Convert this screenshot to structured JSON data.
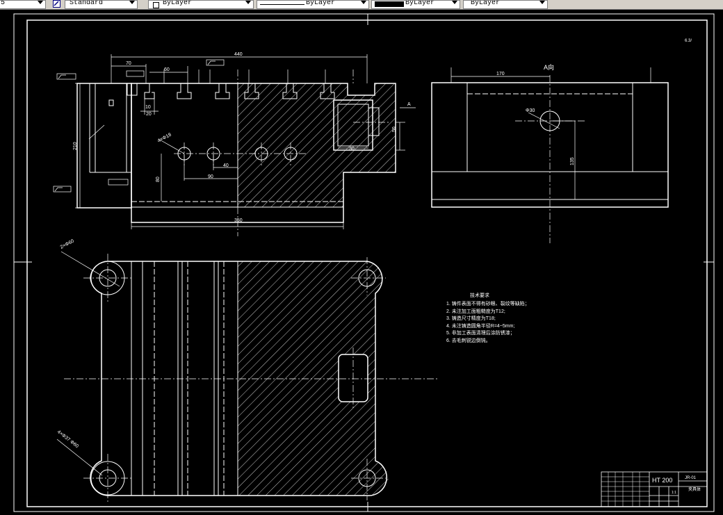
{
  "toolbar": {
    "fields": [
      {
        "value": "5"
      },
      {
        "value": "Standard"
      },
      {
        "value": "ByLayer"
      },
      {
        "value": "ByLayer"
      },
      {
        "value": "ByLayer"
      },
      {
        "value": "ByLayer"
      }
    ]
  },
  "drawing": {
    "section_label": "A",
    "view_label": "A向",
    "roughness_top": "6.3/",
    "notes_title": "技术要求",
    "notes": [
      "1. 铸件表面不得有砂眼、裂纹等缺陷；",
      "2. 未注加工面粗糙度为T12;",
      "3. 铸造尺寸精度为T18;",
      "4. 未注铸造圆角半径R=4~5mm;",
      "5. 非加工表面清理后涂防锈漆；",
      "6. 去毛刺锐边倒钝。"
    ],
    "dims": {
      "d440": "440",
      "d70": "70",
      "d60": "60",
      "d10": "10",
      "d20": "20",
      "d210": "210",
      "d50": "50",
      "d90": "90",
      "d40": "40",
      "d80": "80",
      "d350": "350",
      "d170": "170",
      "d135": "135",
      "d30": "30",
      "d4018": "4×Φ18",
      "phi30": "Φ30",
      "d2phi": "2×Φ60",
      "d4phi": "4×Φ37 Φ60"
    },
    "title_block": {
      "material": "HT 200",
      "part_no": "JR-01",
      "name": "夹具体",
      "scale": "1:1"
    }
  }
}
